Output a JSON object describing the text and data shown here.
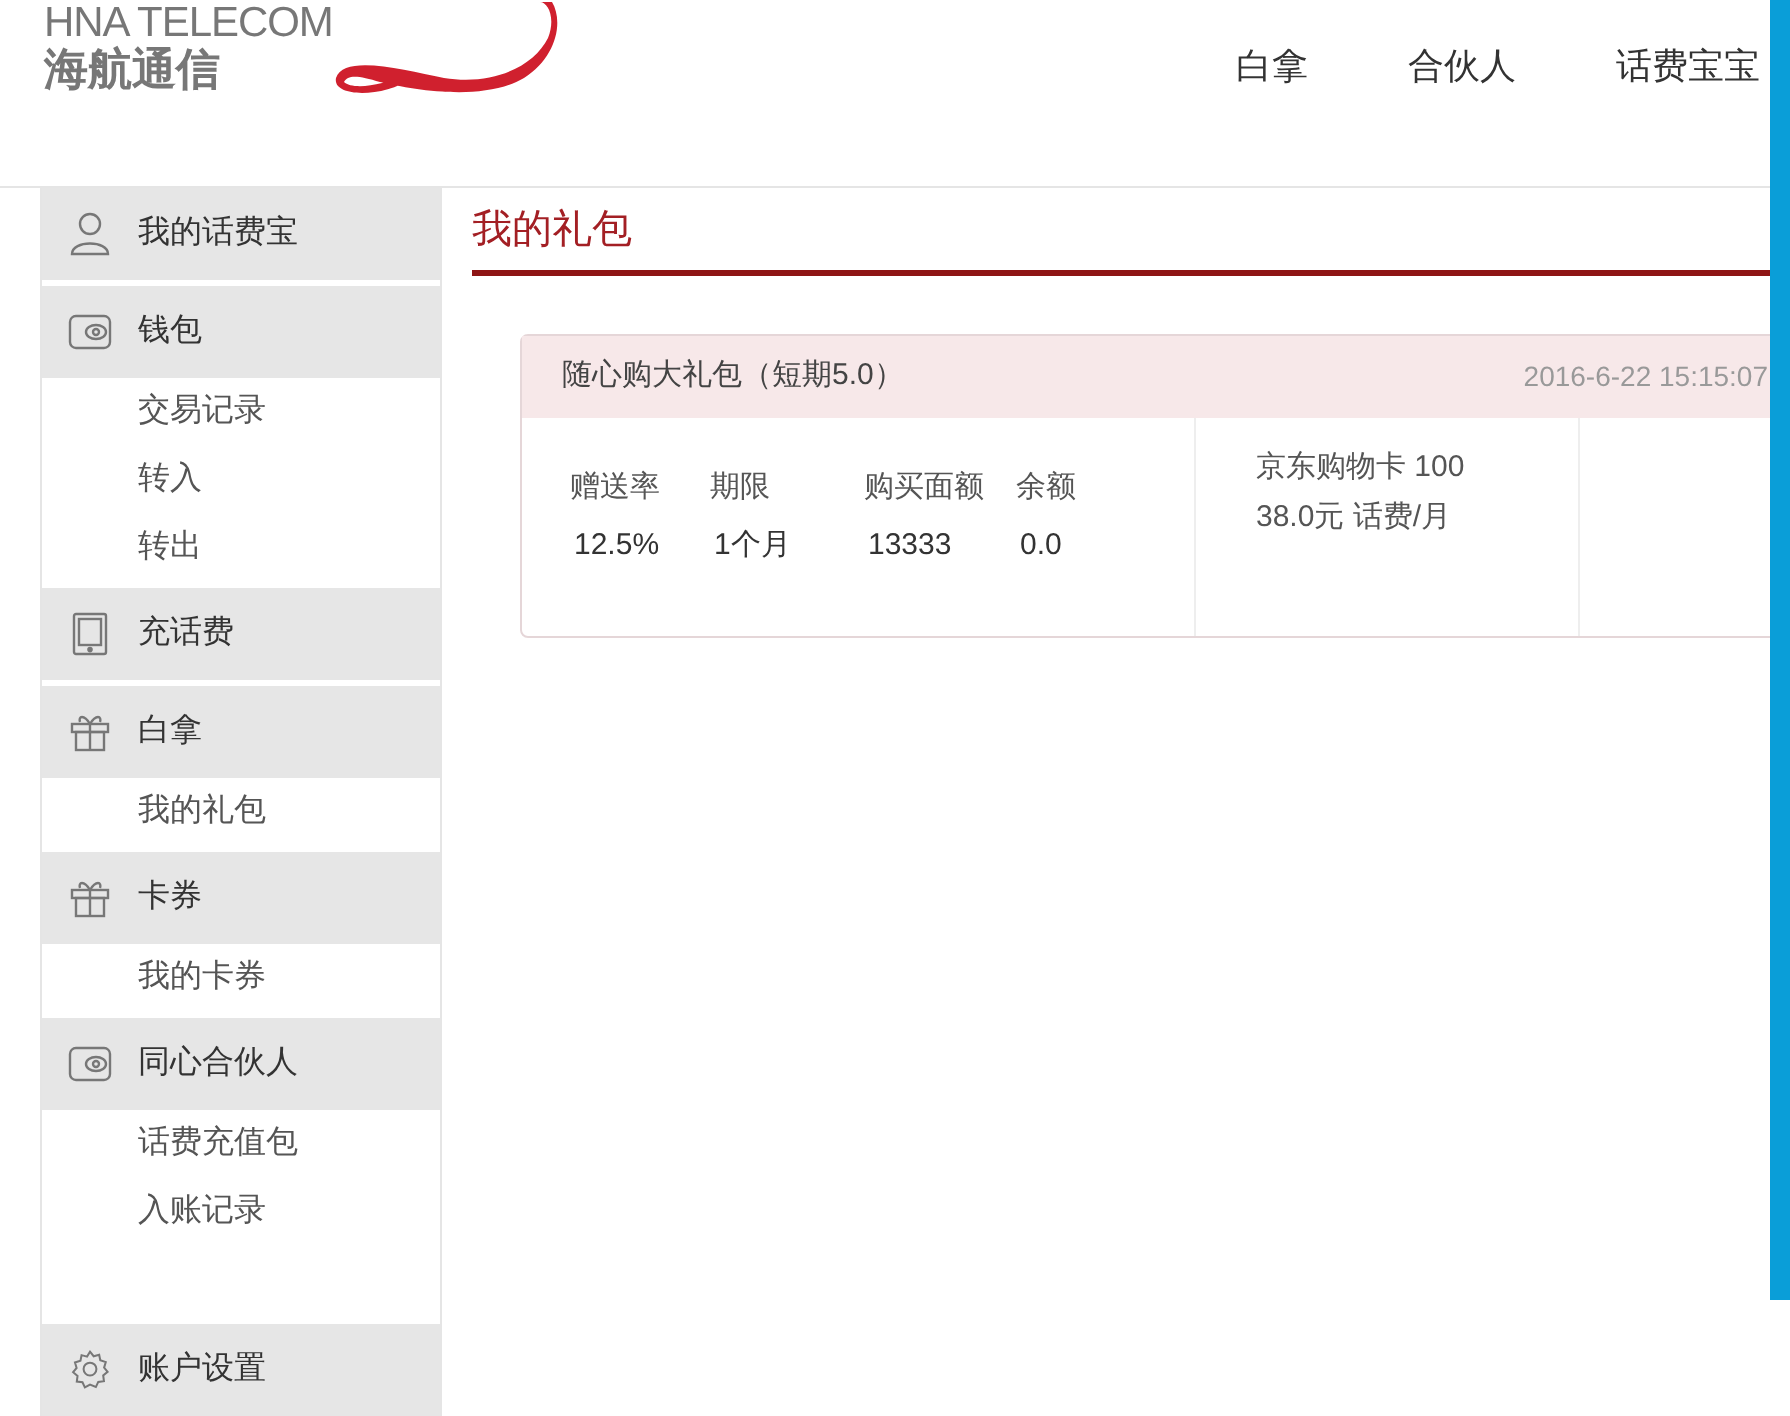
{
  "logo": {
    "latin": "HNA TELECOM",
    "chinese": "海航通信"
  },
  "nav": [
    "白拿",
    "合伙人",
    "话费宝宝"
  ],
  "sidebar": {
    "sections": [
      {
        "label": "我的话费宝"
      },
      {
        "label": "钱包",
        "items": [
          "交易记录",
          "转入",
          "转出"
        ]
      },
      {
        "label": "充话费"
      },
      {
        "label": "白拿",
        "items": [
          "我的礼包"
        ]
      },
      {
        "label": "卡券",
        "items": [
          "我的卡券"
        ]
      },
      {
        "label": "同心合伙人",
        "items": [
          "话费充值包",
          "入账记录"
        ]
      },
      {
        "label": "账户设置"
      }
    ]
  },
  "page_title": "我的礼包",
  "gift_card": {
    "name": "随心购大礼包（短期5.0）",
    "time": "2016-6-22 15:15:07",
    "columns": [
      "赠送率",
      "期限",
      "购买面额",
      "余额"
    ],
    "values": [
      "12.5%",
      "1个月",
      "13333",
      "0.0"
    ],
    "benefits": [
      "京东购物卡 100",
      "38.0元 话费/月"
    ]
  }
}
